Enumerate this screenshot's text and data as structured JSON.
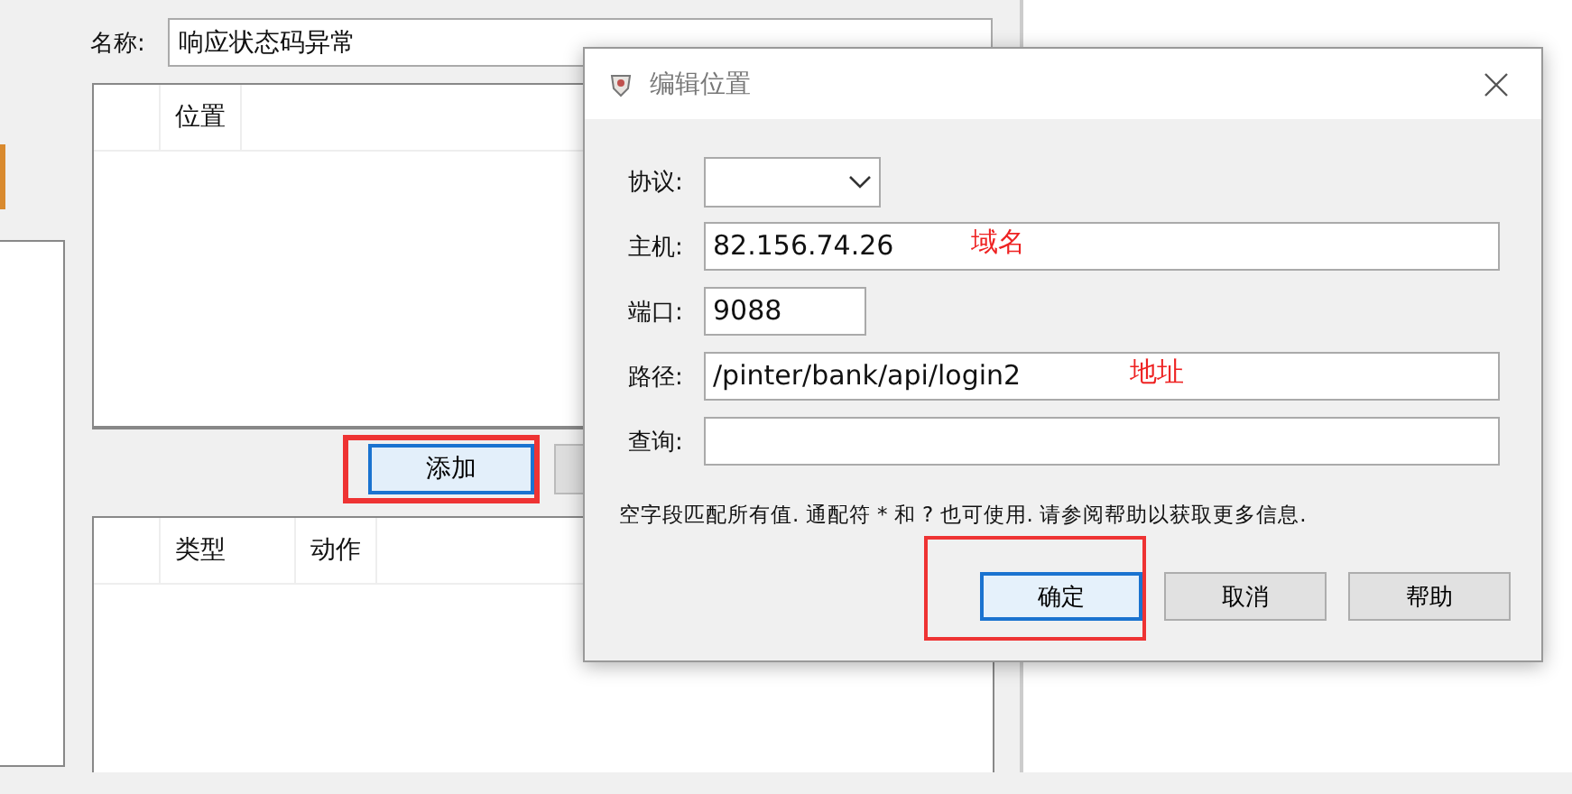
{
  "background_window": {
    "name_label": "名称:",
    "name_value": "响应状态码异常",
    "locations_table": {
      "columns": [
        "位置"
      ]
    },
    "add_button": {
      "label": "添加",
      "highlighted": true
    },
    "actions_table": {
      "columns": [
        "类型",
        "动作"
      ]
    }
  },
  "dialog": {
    "title": "编辑位置",
    "fields": [
      {
        "label": "协议:",
        "kind": "combo"
      },
      {
        "label": "主机:",
        "kind": "text",
        "value": "82.156.74.26",
        "annotation": "域名"
      },
      {
        "label": "端口:",
        "kind": "number",
        "value": "9088"
      },
      {
        "label": "路径:",
        "kind": "text",
        "value": "/pinter/bank/api/login2",
        "annotation": "地址"
      },
      {
        "label": "查询:",
        "kind": "text"
      }
    ],
    "note": "空字段匹配所有值. 通配符 * 和 ? 也可使用. 请参阅帮助以获取更多信息.",
    "buttons": [
      {
        "label": "确定",
        "focused": true,
        "highlighted": true
      },
      {
        "label": "取消",
        "focused": false,
        "highlighted": false
      },
      {
        "label": "帮助",
        "focused": false,
        "highlighted": false
      }
    ]
  }
}
